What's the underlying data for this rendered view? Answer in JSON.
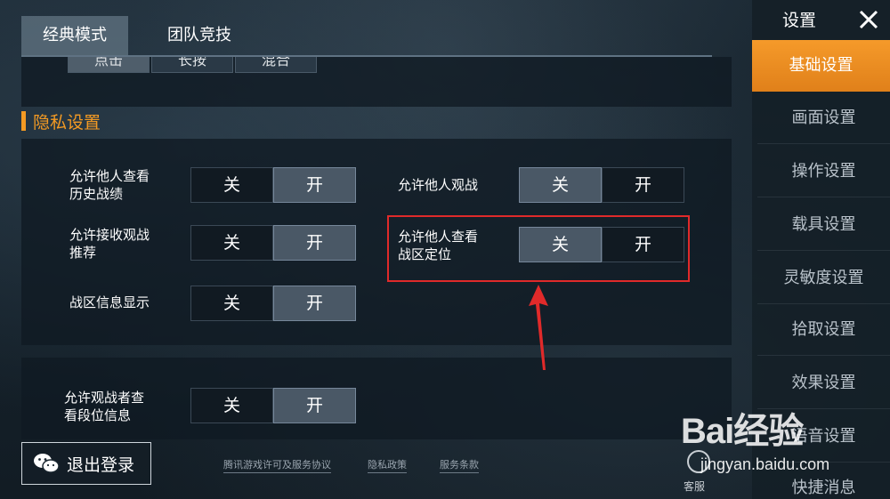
{
  "tabs": [
    {
      "label": "经典模式",
      "active": true
    },
    {
      "label": "团队竞技",
      "active": false
    }
  ],
  "cut_row": [
    "点击",
    "长按",
    "混合"
  ],
  "section": {
    "title": "隐私设置"
  },
  "settings": [
    {
      "label_1": "允许他人查看",
      "label_2": "历史战绩",
      "off": "关",
      "on": "开",
      "selected": "开"
    },
    {
      "label_1": "允许接收观战",
      "label_2": "推荐",
      "off": "关",
      "on": "开",
      "selected": "开"
    },
    {
      "label_1": "战区信息显示",
      "label_2": "",
      "off": "关",
      "on": "开",
      "selected": "开"
    },
    {
      "label_1": "允许他人观战",
      "label_2": "",
      "off": "关",
      "on": "开",
      "selected": "关"
    },
    {
      "label_1": "允许他人查看",
      "label_2": "战区定位",
      "off": "关",
      "on": "开",
      "selected": "关"
    },
    {
      "label_1": "允许观战者查",
      "label_2": "看段位信息",
      "off": "关",
      "on": "开",
      "selected": "开"
    }
  ],
  "sidebar": {
    "title": "设置",
    "items": [
      {
        "label": "基础设置",
        "active": true
      },
      {
        "label": "画面设置"
      },
      {
        "label": "操作设置"
      },
      {
        "label": "载具设置"
      },
      {
        "label": "灵敏度设置"
      },
      {
        "label": "拾取设置"
      },
      {
        "label": "效果设置"
      },
      {
        "label": "语音设置"
      },
      {
        "label": "快捷消息"
      }
    ]
  },
  "footer": {
    "logout_label": "退出登录",
    "links": [
      "腾讯游戏许可及服务协议",
      "隐私政策",
      "服务条款"
    ],
    "service_label": "客服"
  },
  "watermark": {
    "brand": "Bai经验",
    "url": "jingyan.baidu.com"
  },
  "colors": {
    "accent": "#f49a23",
    "highlight_box": "#e02a2a"
  }
}
